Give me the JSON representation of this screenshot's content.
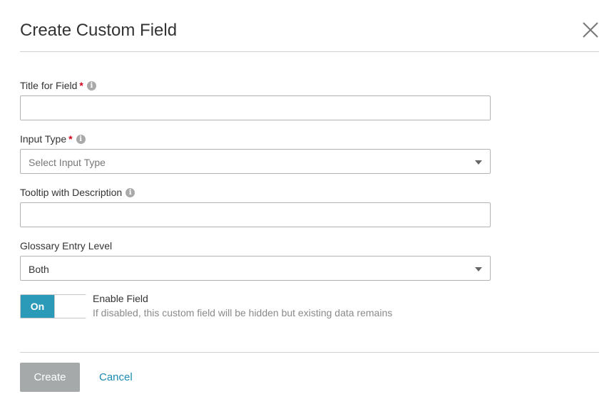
{
  "dialog": {
    "title": "Create Custom Field",
    "close_icon": "close-icon"
  },
  "fields": {
    "title_for_field": {
      "label": "Title for Field",
      "required_mark": "*",
      "value": "",
      "info_icon": "info-icon"
    },
    "input_type": {
      "label": "Input Type",
      "required_mark": "*",
      "selected": "Select Input Type",
      "is_placeholder": true,
      "info_icon": "info-icon"
    },
    "tooltip_description": {
      "label": "Tooltip with Description",
      "value": "",
      "info_icon": "info-icon"
    },
    "glossary_entry_level": {
      "label": "Glossary Entry Level",
      "selected": "Both"
    }
  },
  "enable_field": {
    "toggle_label": "On",
    "state": true,
    "title": "Enable Field",
    "description": "If disabled, this custom field will be hidden but existing data remains"
  },
  "footer": {
    "create_label": "Create",
    "cancel_label": "Cancel"
  },
  "colors": {
    "accent": "#2a9ab8",
    "link": "#1a8bb3",
    "required": "#d0021b",
    "disabled_button": "#a5a9a9"
  }
}
